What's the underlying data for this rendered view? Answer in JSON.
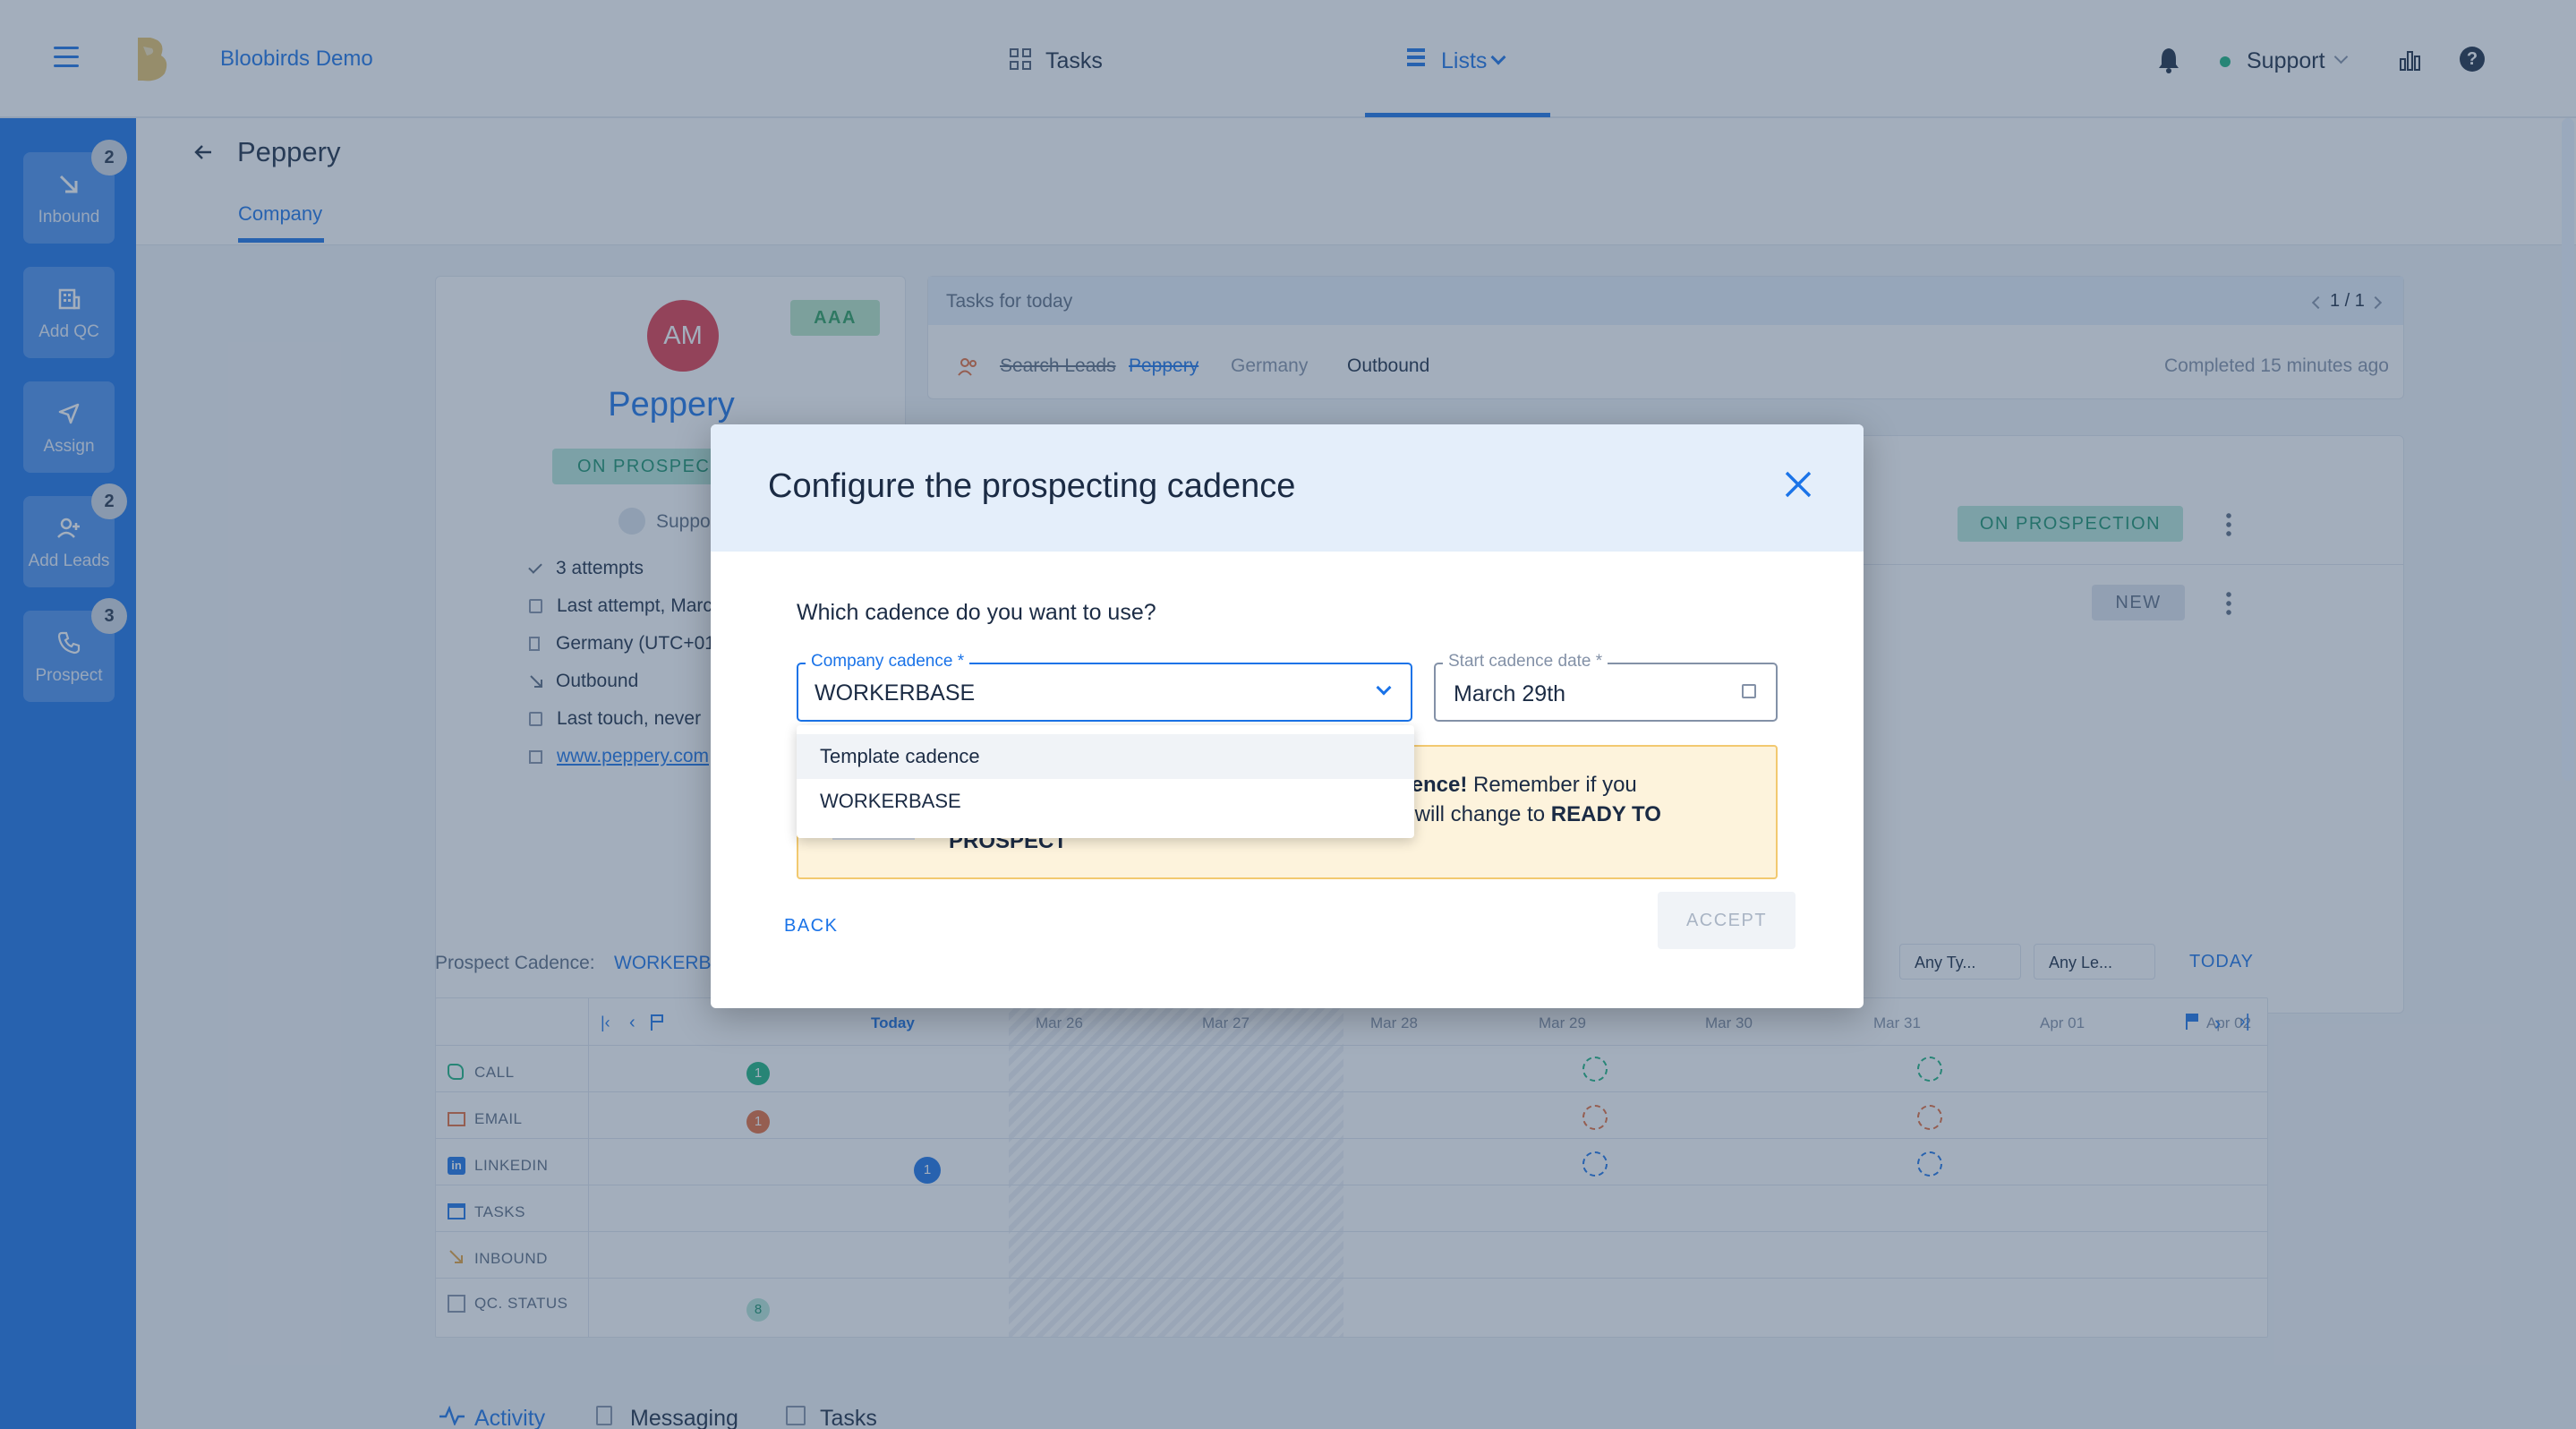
{
  "header": {
    "menu_icon": "hamburger-icon",
    "app_name": "Bloobirds Demo",
    "nav_tasks": "Tasks",
    "nav_lists": "Lists",
    "user_name": "Support",
    "user_status_color": "#1bb37f"
  },
  "sidebar": {
    "items": [
      {
        "label": "Inbound",
        "badge": "2",
        "icon": "arrow-down-right-icon"
      },
      {
        "label": "Add QC",
        "badge": "",
        "icon": "building-icon"
      },
      {
        "label": "Assign",
        "badge": "",
        "icon": "send-icon"
      },
      {
        "label": "Add Leads",
        "badge": "2",
        "icon": "add-user-icon"
      },
      {
        "label": "Prospect",
        "badge": "3",
        "icon": "phone-icon"
      }
    ]
  },
  "page": {
    "title": "Peppery",
    "tab_company": "Company"
  },
  "company": {
    "initials": "AM",
    "avatar_color": "#e23a4a",
    "name": "Peppery",
    "rating": "AAA",
    "status": "ON PROSPEC",
    "owner": "Suppo",
    "details": [
      "3 attempts",
      "Last attempt, Marc",
      "Germany (UTC+01",
      "Outbound",
      "Last touch, never",
      "www.peppery.com"
    ]
  },
  "tasks_panel": {
    "title": "Tasks for today",
    "pager": "1 / 1",
    "task_name": "Search Leads",
    "task_company": "Peppery",
    "task_country": "Germany",
    "task_source": "Outbound",
    "task_done": "Completed 15 minutes ago"
  },
  "right_list": {
    "status_1": "ON PROSPECTION",
    "status_2": "NEW"
  },
  "cadence_bar": {
    "label": "Prospect Cadence:",
    "value": "WORKERBA",
    "filter_type": "Any Ty...",
    "filter_lead": "Any Le...",
    "today_btn": "TODAY"
  },
  "timeline": {
    "dates": [
      "Today",
      "Mar 26",
      "Mar 27",
      "Mar 28",
      "Mar 29",
      "Mar 30",
      "Mar 31",
      "Apr 01",
      "Apr 02"
    ],
    "rows": [
      "CALL",
      "EMAIL",
      "LINKEDIN",
      "TASKS",
      "INBOUND",
      "QC. STATUS"
    ],
    "call_count": "1",
    "email_count": "1",
    "linkedin_count": "1",
    "qc_count": "8"
  },
  "bottom_tabs": [
    "Activity",
    "Messaging",
    "Tasks"
  ],
  "modal": {
    "title": "Configure the prospecting cadence",
    "question": "Which cadence do you want to use?",
    "cadence_label": "Company cadence *",
    "cadence_value": "WORKERBASE",
    "date_label": "Start cadence date *",
    "date_value": "March 29th",
    "options": [
      "Template cadence",
      "WORKERBASE"
    ],
    "warn_bold": "dence!",
    "warn_text_1": " Remember if you",
    "warn_text_2": "y will change to ",
    "warn_bold_2": "READY TO",
    "warn_bold_3": "PROSPECT",
    "back": "BACK",
    "accept": "ACCEPT"
  }
}
